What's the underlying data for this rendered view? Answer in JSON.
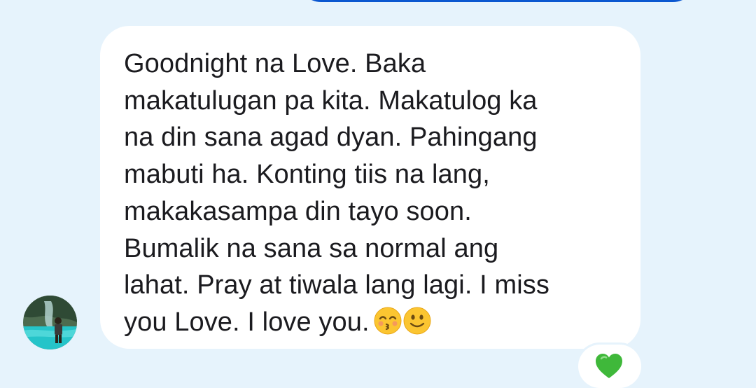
{
  "message": {
    "text_lines": [
      "Goodnight na Love. Baka",
      "makatulugan pa kita. Makatulog ka",
      "na din sana agad dyan. Pahingang",
      "mabuti ha. Konting tiis na lang,",
      "makakasampa din tayo soon.",
      "Bumalik na sana sa normal ang",
      "lahat. Pray at tiwala lang lagi. I miss",
      "you Love. I love you."
    ],
    "emojis": [
      "kissing-face-with-smiling-eyes-icon",
      "slightly-smiling-face-icon"
    ]
  },
  "reaction": {
    "emoji": "green-heart-icon",
    "color": "#3fb83a"
  },
  "colors": {
    "background": "#e6f3fc",
    "bubble": "#ffffff",
    "text": "#1b1b1f",
    "sent_bubble": "#0b57d0"
  }
}
